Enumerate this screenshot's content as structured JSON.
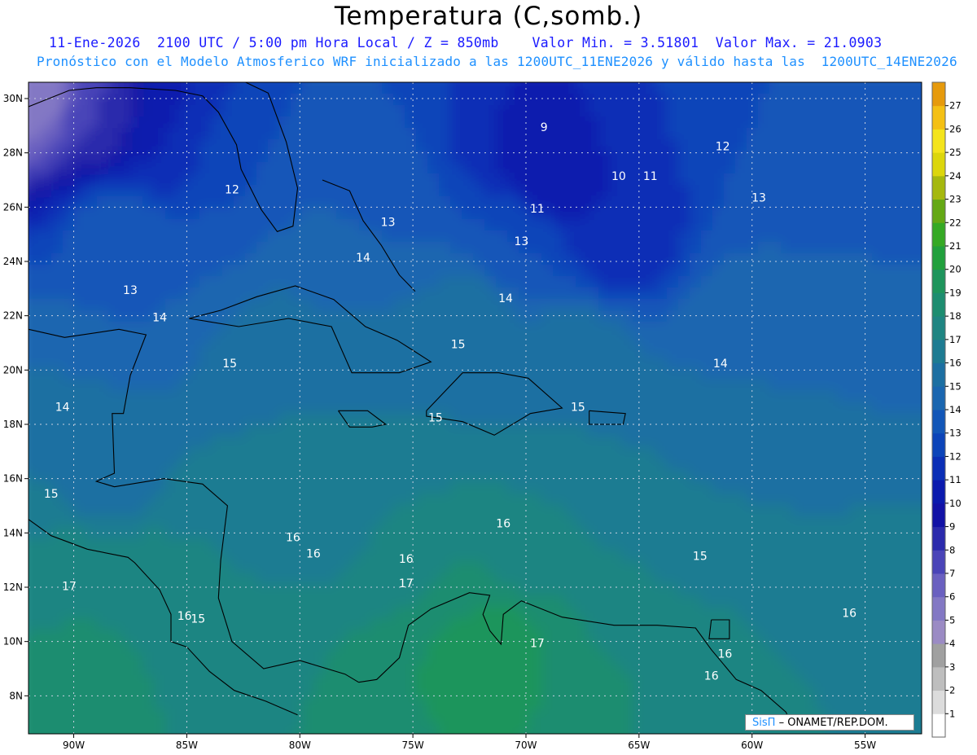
{
  "title": "Temperatura (C,somb.)",
  "subtitle_1": "11-Ene-2026  2100 UTC / 5:00 pm Hora Local / Z = 850mb    Valor Min. = 3.51801  Valor Max. = 21.0903",
  "subtitle_2": "Pronóstico con el Modelo Atmosferico WRF inicializado a las 1200UTC_11ENE2026 y válido hasta las  1200UTC_14ENE2026",
  "credit": {
    "brand": "SisΠ",
    "org": "– ONAMET/REP.DOM."
  },
  "map": {
    "lon_range": [
      -92,
      -52.5
    ],
    "lat_range": [
      6.6,
      30.6
    ],
    "lon_ticks": [
      {
        "value": -90,
        "label": "90W"
      },
      {
        "value": -85,
        "label": "85W"
      },
      {
        "value": -80,
        "label": "80W"
      },
      {
        "value": -75,
        "label": "75W"
      },
      {
        "value": -70,
        "label": "70W"
      },
      {
        "value": -65,
        "label": "65W"
      },
      {
        "value": -60,
        "label": "60W"
      },
      {
        "value": -55,
        "label": "55W"
      }
    ],
    "lat_ticks": [
      {
        "value": 30,
        "label": "30N"
      },
      {
        "value": 28,
        "label": "28N"
      },
      {
        "value": 26,
        "label": "26N"
      },
      {
        "value": 24,
        "label": "24N"
      },
      {
        "value": 22,
        "label": "22N"
      },
      {
        "value": 20,
        "label": "20N"
      },
      {
        "value": 18,
        "label": "18N"
      },
      {
        "value": 16,
        "label": "16N"
      },
      {
        "value": 14,
        "label": "14N"
      },
      {
        "value": 12,
        "label": "12N"
      },
      {
        "value": 10,
        "label": "10N"
      },
      {
        "value": 8,
        "label": "8N"
      }
    ],
    "field_anchors": [
      {
        "lon": -91.5,
        "lat": 30.3,
        "t": 4.5
      },
      {
        "lon": -89,
        "lat": 29.5,
        "t": 7
      },
      {
        "lon": -86,
        "lat": 28.5,
        "t": 10
      },
      {
        "lon": -83,
        "lat": 27,
        "t": 12
      },
      {
        "lon": -88,
        "lat": 25,
        "t": 12.5
      },
      {
        "lon": -85,
        "lat": 23,
        "t": 13
      },
      {
        "lon": -80,
        "lat": 22.5,
        "t": 14
      },
      {
        "lon": -77,
        "lat": 26,
        "t": 13
      },
      {
        "lon": -76,
        "lat": 29,
        "t": 12
      },
      {
        "lon": -71,
        "lat": 29.5,
        "t": 10
      },
      {
        "lon": -69,
        "lat": 27.5,
        "t": 9
      },
      {
        "lon": -66,
        "lat": 25.5,
        "t": 10
      },
      {
        "lon": -70.5,
        "lat": 24.5,
        "t": 12
      },
      {
        "lon": -64,
        "lat": 29,
        "t": 11
      },
      {
        "lon": -59,
        "lat": 28.5,
        "t": 12
      },
      {
        "lon": -54,
        "lat": 29,
        "t": 12
      },
      {
        "lon": -58,
        "lat": 25.5,
        "t": 13
      },
      {
        "lon": -54,
        "lat": 24,
        "t": 13
      },
      {
        "lon": -60,
        "lat": 21,
        "t": 14
      },
      {
        "lon": -55,
        "lat": 19,
        "t": 14
      },
      {
        "lon": -72,
        "lat": 22,
        "t": 14.5
      },
      {
        "lon": -68,
        "lat": 20,
        "t": 15
      },
      {
        "lon": -75,
        "lat": 19,
        "t": 15
      },
      {
        "lon": -82,
        "lat": 20,
        "t": 15
      },
      {
        "lon": -90.5,
        "lat": 19,
        "t": 14
      },
      {
        "lon": -89,
        "lat": 16.5,
        "t": 14
      },
      {
        "lon": -91.5,
        "lat": 15,
        "t": 15
      },
      {
        "lon": -91,
        "lat": 13,
        "t": 17
      },
      {
        "lon": -88,
        "lat": 11.5,
        "t": 17
      },
      {
        "lon": -84,
        "lat": 13,
        "t": 16
      },
      {
        "lon": -80,
        "lat": 15,
        "t": 15.5
      },
      {
        "lon": -76,
        "lat": 14,
        "t": 16
      },
      {
        "lon": -70,
        "lat": 14,
        "t": 16
      },
      {
        "lon": -64,
        "lat": 15,
        "t": 15
      },
      {
        "lon": -58,
        "lat": 14,
        "t": 15
      },
      {
        "lon": -54,
        "lat": 11,
        "t": 16
      },
      {
        "lon": -58,
        "lat": 9,
        "t": 16
      },
      {
        "lon": -62,
        "lat": 8,
        "t": 16.5
      },
      {
        "lon": -68,
        "lat": 9,
        "t": 18
      },
      {
        "lon": -72,
        "lat": 10,
        "t": 19
      },
      {
        "lon": -75,
        "lat": 8,
        "t": 18
      },
      {
        "lon": -80,
        "lat": 8,
        "t": 17
      },
      {
        "lon": -85,
        "lat": 9,
        "t": 17
      },
      {
        "lon": -90,
        "lat": 8,
        "t": 17.5
      },
      {
        "lon": -73,
        "lat": 12,
        "t": 17
      },
      {
        "lon": -66,
        "lat": 11,
        "t": 16.5
      }
    ],
    "contour_labels": [
      {
        "lon": -69.2,
        "lat": 28.8,
        "text": "9"
      },
      {
        "lon": -61.3,
        "lat": 28.1,
        "text": "12"
      },
      {
        "lon": -65.9,
        "lat": 27.0,
        "text": "10"
      },
      {
        "lon": -64.5,
        "lat": 27.0,
        "text": "11"
      },
      {
        "lon": -83.0,
        "lat": 26.5,
        "text": "12"
      },
      {
        "lon": -59.7,
        "lat": 26.2,
        "text": "13"
      },
      {
        "lon": -69.5,
        "lat": 25.8,
        "text": "11"
      },
      {
        "lon": -76.1,
        "lat": 25.3,
        "text": "13"
      },
      {
        "lon": -70.2,
        "lat": 24.6,
        "text": "13"
      },
      {
        "lon": -77.2,
        "lat": 24.0,
        "text": "14"
      },
      {
        "lon": -87.5,
        "lat": 22.8,
        "text": "13"
      },
      {
        "lon": -70.9,
        "lat": 22.5,
        "text": "14"
      },
      {
        "lon": -86.2,
        "lat": 21.8,
        "text": "14"
      },
      {
        "lon": -73.0,
        "lat": 20.8,
        "text": "15"
      },
      {
        "lon": -83.1,
        "lat": 20.1,
        "text": "15"
      },
      {
        "lon": -61.4,
        "lat": 20.1,
        "text": "14"
      },
      {
        "lon": -90.5,
        "lat": 18.5,
        "text": "14"
      },
      {
        "lon": -67.7,
        "lat": 18.5,
        "text": "15"
      },
      {
        "lon": -74.0,
        "lat": 18.1,
        "text": "15"
      },
      {
        "lon": -91.0,
        "lat": 15.3,
        "text": "15"
      },
      {
        "lon": -71.0,
        "lat": 14.2,
        "text": "16"
      },
      {
        "lon": -80.3,
        "lat": 13.7,
        "text": "16"
      },
      {
        "lon": -79.4,
        "lat": 13.1,
        "text": "16"
      },
      {
        "lon": -75.3,
        "lat": 12.9,
        "text": "16"
      },
      {
        "lon": -62.3,
        "lat": 13.0,
        "text": "15"
      },
      {
        "lon": -90.2,
        "lat": 11.9,
        "text": "17"
      },
      {
        "lon": -75.3,
        "lat": 12.0,
        "text": "17"
      },
      {
        "lon": -85.1,
        "lat": 10.8,
        "text": "16"
      },
      {
        "lon": -84.5,
        "lat": 10.7,
        "text": "15"
      },
      {
        "lon": -55.7,
        "lat": 10.9,
        "text": "16"
      },
      {
        "lon": -69.5,
        "lat": 9.8,
        "text": "17"
      },
      {
        "lon": -61.2,
        "lat": 9.4,
        "text": "16"
      },
      {
        "lon": -61.8,
        "lat": 8.6,
        "text": "16"
      }
    ]
  },
  "colorbar": {
    "levels": [
      1,
      2,
      3,
      4,
      5,
      6,
      7,
      8,
      9,
      10,
      11,
      12,
      13,
      14,
      15,
      16,
      17,
      18,
      19,
      20,
      21,
      22,
      23,
      24,
      25,
      26,
      27
    ],
    "colors": [
      "#ffffff",
      "#dcdcdc",
      "#bebebe",
      "#a0a0a0",
      "#9b8bc4",
      "#8378c4",
      "#6a60c0",
      "#4a44b8",
      "#2b2aac",
      "#1212a6",
      "#0b1aae",
      "#0a2eb6",
      "#0c44b9",
      "#1256b8",
      "#1a66b0",
      "#1c6fa2",
      "#1d7b92",
      "#1f8582",
      "#1d8d70",
      "#1e955c",
      "#21a03c",
      "#35a924",
      "#64a814",
      "#a5b80e",
      "#dcd60c",
      "#f4e41c",
      "#f4c014",
      "#e69a0c",
      "#c6820a"
    ]
  }
}
